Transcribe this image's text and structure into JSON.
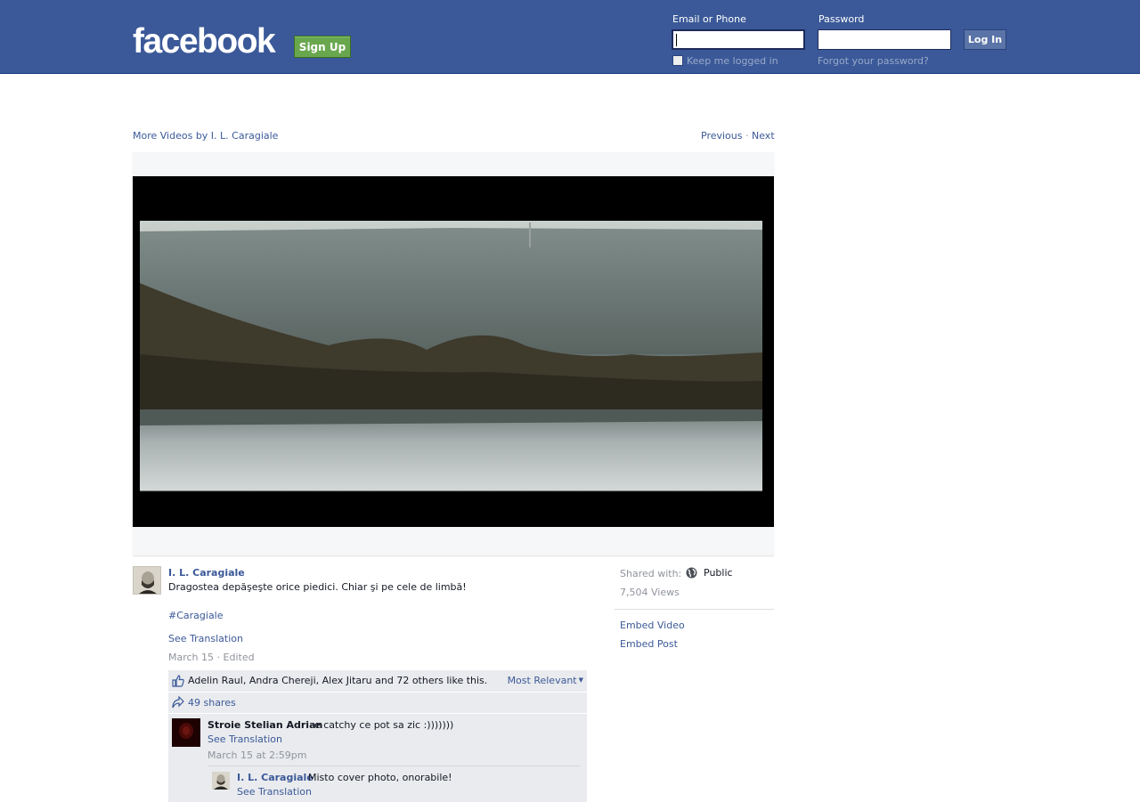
{
  "header": {
    "logo": "facebook",
    "signup_label": "Sign Up",
    "email_label": "Email or Phone",
    "email_value": "",
    "password_label": "Password",
    "password_value": "",
    "login_label": "Log In",
    "keep_logged_in": "Keep me logged in",
    "forgot_password": "Forgot your password?"
  },
  "nav": {
    "more_videos": "More Videos by I. L. Caragiale",
    "previous": "Previous",
    "dot": " · ",
    "next": "Next"
  },
  "post": {
    "author": "I. L. Caragiale",
    "text": "Dragostea depăşeşte orice piedici. Chiar şi pe cele de limbă!",
    "hashtag": "#Caragiale",
    "see_translation": "See Translation",
    "date": "March 15 · Edited"
  },
  "sidebar": {
    "shared_with_label": "Shared with:",
    "privacy": "Public",
    "views": "7,504 Views",
    "embed_video": "Embed Video",
    "embed_post": "Embed Post"
  },
  "ufi": {
    "likes_text": "Adelin Raul, Andra Chereji, Alex Jitaru and 72 others like this.",
    "sort_label": "Most Relevant",
    "shares": "49 shares",
    "comment": {
      "name": "Stroie Stelian Adrian",
      "text": "e catchy ce pot sa zic :)))))))",
      "see_translation": "See Translation",
      "time": "March 15 at 2:59pm"
    },
    "reply": {
      "name": "I. L. Caragiale",
      "text": "Misto cover photo, onorabile!",
      "see_translation": "See Translation"
    }
  },
  "colors": {
    "brand_blue": "#3b5998",
    "signup_green": "#69a74e"
  },
  "icons": [
    "checkbox-icon",
    "globe-icon",
    "like-thumb-icon",
    "share-arrow-icon",
    "caret-down-icon"
  ]
}
